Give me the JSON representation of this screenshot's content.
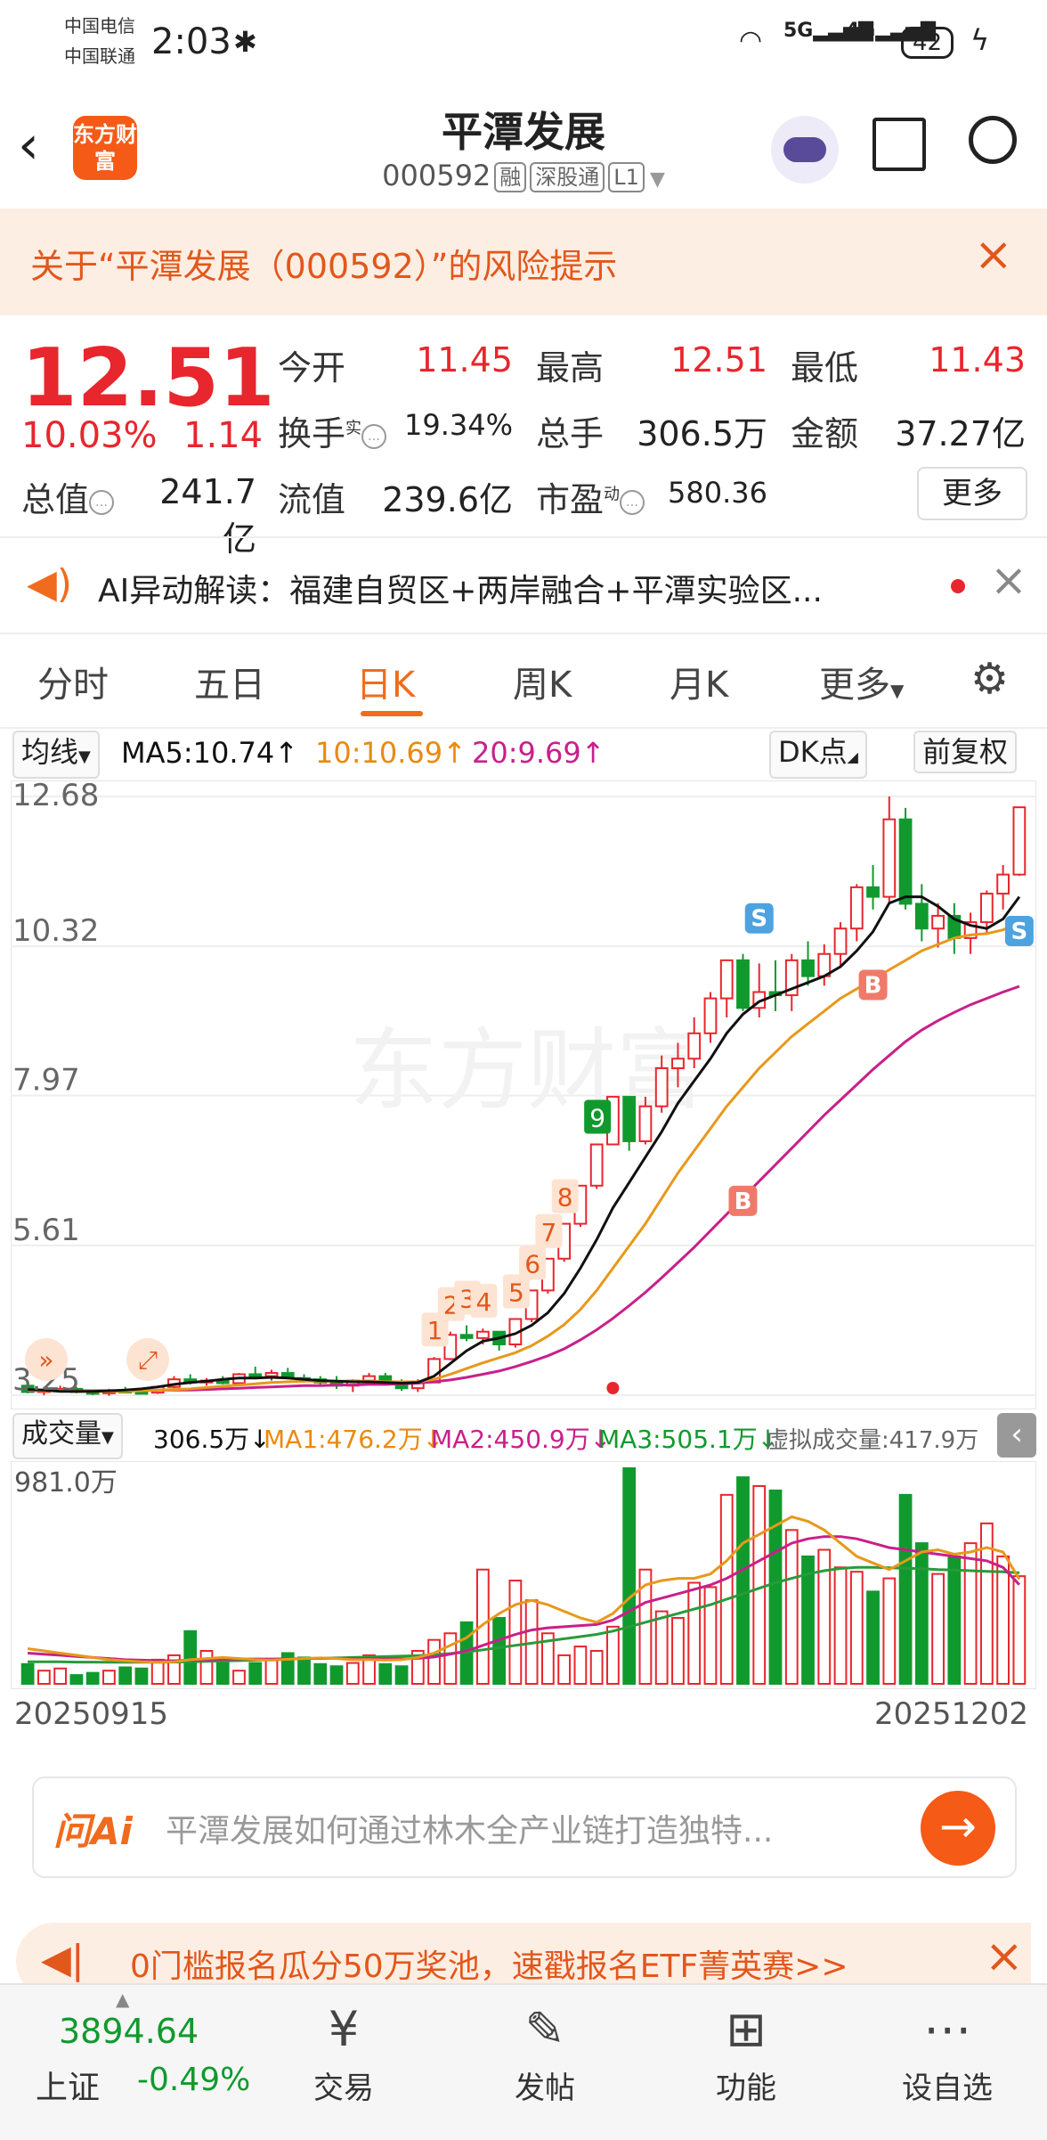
{
  "status_bar": {
    "carrier1": "中国电信",
    "carrier2": "中国联通",
    "time": "2:03",
    "battery": "42"
  },
  "header": {
    "brand_logo": "东方财富",
    "title": "平潭发展",
    "code": "000592",
    "tags": [
      "融",
      "深股通",
      "L1"
    ]
  },
  "risk_banner": {
    "text": "关于“平潭发展（000592）”的风险提示"
  },
  "quote": {
    "price": "12.51",
    "change_pct": "10.03%",
    "change": "1.14",
    "open_label": "今开",
    "open": "11.45",
    "high_label": "最高",
    "high": "12.51",
    "low_label": "最低",
    "low": "11.43",
    "turnover_label": "换手",
    "turnover_sup": "实",
    "turnover": "19.34%",
    "volume_label": "总手",
    "volume": "306.5万",
    "amount_label": "金额",
    "amount": "37.27亿",
    "mktcap_label": "总值",
    "mktcap": "241.7亿",
    "float_label": "流值",
    "float": "239.6亿",
    "pe_label": "市盈",
    "pe_sup": "动",
    "pe": "580.36",
    "more_label": "更多"
  },
  "ai_bar": {
    "text": "AI异动解读：福建自贸区+两岸融合+平潭实验区..."
  },
  "tabs": [
    "分时",
    "五日",
    "日K",
    "周K",
    "月K",
    "更多"
  ],
  "active_tab": "日K",
  "ma": {
    "selector": "均线",
    "ma5": "MA5:10.74↑",
    "ma10": "10:10.69↑",
    "ma20": "20:9.69↑",
    "dk_label": "DK点",
    "adjust_label": "前复权"
  },
  "volume_row": {
    "selector": "成交量",
    "vol": "306.5万↓",
    "ma1": "MA1:476.2万↓",
    "ma2": "MA2:450.9万↓",
    "ma3": "MA3:505.1万↓",
    "virtual": "虚拟成交量:417.9万"
  },
  "chart_data": {
    "type": "candlestick",
    "y_ticks": [
      "12.68",
      "10.32",
      "7.97",
      "5.61",
      "3.25"
    ],
    "ylim": [
      3.25,
      12.68
    ],
    "volume_max_label": "981.0万",
    "volume_max": 981.0,
    "x_start": "20250915",
    "x_end": "20251202",
    "up_color": "#e8262d",
    "down_color": "#109a2e",
    "ma5_color": "#111111",
    "ma10_color": "#e8981a",
    "ma20_color": "#c8208a",
    "candles": [
      [
        3.4,
        3.45,
        3.28,
        3.3
      ],
      [
        3.3,
        3.38,
        3.25,
        3.33
      ],
      [
        3.33,
        3.4,
        3.3,
        3.35
      ],
      [
        3.35,
        3.38,
        3.28,
        3.3
      ],
      [
        3.3,
        3.33,
        3.25,
        3.28
      ],
      [
        3.28,
        3.35,
        3.24,
        3.32
      ],
      [
        3.32,
        3.38,
        3.28,
        3.3
      ],
      [
        3.3,
        3.34,
        3.26,
        3.29
      ],
      [
        3.29,
        3.4,
        3.27,
        3.38
      ],
      [
        3.38,
        3.55,
        3.35,
        3.5
      ],
      [
        3.5,
        3.58,
        3.42,
        3.45
      ],
      [
        3.45,
        3.52,
        3.4,
        3.48
      ],
      [
        3.48,
        3.55,
        3.42,
        3.44
      ],
      [
        3.44,
        3.6,
        3.4,
        3.58
      ],
      [
        3.58,
        3.7,
        3.5,
        3.55
      ],
      [
        3.55,
        3.65,
        3.48,
        3.6
      ],
      [
        3.6,
        3.68,
        3.5,
        3.52
      ],
      [
        3.52,
        3.58,
        3.45,
        3.5
      ],
      [
        3.5,
        3.55,
        3.4,
        3.45
      ],
      [
        3.45,
        3.55,
        3.35,
        3.4
      ],
      [
        3.4,
        3.5,
        3.3,
        3.48
      ],
      [
        3.48,
        3.6,
        3.42,
        3.55
      ],
      [
        3.55,
        3.6,
        3.4,
        3.45
      ],
      [
        3.45,
        3.5,
        3.32,
        3.36
      ],
      [
        3.36,
        3.5,
        3.3,
        3.45
      ],
      [
        3.45,
        3.85,
        3.45,
        3.82
      ],
      [
        3.82,
        4.25,
        3.8,
        4.2
      ],
      [
        4.2,
        4.35,
        4.1,
        4.15
      ],
      [
        4.15,
        4.3,
        4.05,
        4.25
      ],
      [
        4.25,
        4.2,
        3.95,
        4.05
      ],
      [
        4.05,
        4.45,
        4.0,
        4.45
      ],
      [
        4.45,
        4.9,
        4.4,
        4.9
      ],
      [
        4.9,
        5.4,
        4.85,
        5.4
      ],
      [
        5.4,
        5.95,
        5.35,
        5.95
      ],
      [
        5.95,
        6.55,
        5.9,
        6.55
      ],
      [
        6.55,
        7.2,
        6.5,
        7.2
      ],
      [
        7.2,
        7.95,
        7.2,
        7.95
      ],
      [
        7.95,
        7.3,
        7.1,
        7.25
      ],
      [
        7.25,
        7.95,
        7.2,
        7.8
      ],
      [
        7.8,
        8.6,
        7.7,
        8.4
      ],
      [
        8.4,
        8.8,
        8.1,
        8.55
      ],
      [
        8.55,
        9.2,
        8.4,
        8.95
      ],
      [
        8.95,
        9.6,
        8.8,
        9.5
      ],
      [
        9.5,
        10.1,
        9.2,
        10.1
      ],
      [
        10.1,
        10.2,
        9.3,
        9.35
      ],
      [
        9.35,
        10.05,
        9.2,
        9.6
      ],
      [
        9.6,
        10.1,
        9.3,
        9.55
      ],
      [
        9.55,
        10.2,
        9.3,
        10.1
      ],
      [
        10.1,
        10.4,
        9.7,
        9.85
      ],
      [
        9.85,
        10.35,
        9.7,
        10.2
      ],
      [
        10.2,
        10.7,
        10.0,
        10.6
      ],
      [
        10.6,
        11.3,
        10.4,
        11.25
      ],
      [
        11.25,
        11.6,
        10.9,
        11.1
      ],
      [
        11.1,
        12.68,
        11.0,
        12.32
      ],
      [
        12.32,
        12.5,
        10.9,
        10.99
      ],
      [
        10.99,
        11.3,
        10.4,
        10.6
      ],
      [
        10.6,
        11.0,
        10.3,
        10.8
      ],
      [
        10.8,
        11.0,
        10.2,
        10.45
      ],
      [
        10.45,
        10.85,
        10.2,
        10.7
      ],
      [
        10.7,
        11.2,
        10.5,
        11.15
      ],
      [
        11.15,
        11.6,
        10.9,
        11.45
      ],
      [
        11.45,
        12.51,
        11.43,
        12.51
      ]
    ],
    "ma5": [
      3.34,
      3.33,
      3.31,
      3.31,
      3.31,
      3.32,
      3.33,
      3.35,
      3.38,
      3.42,
      3.45,
      3.47,
      3.5,
      3.52,
      3.52,
      3.53,
      3.52,
      3.5,
      3.48,
      3.47,
      3.46,
      3.46,
      3.45,
      3.44,
      3.45,
      3.55,
      3.75,
      3.95,
      4.1,
      4.15,
      4.22,
      4.35,
      4.55,
      4.85,
      5.25,
      5.7,
      6.2,
      6.6,
      7.0,
      7.4,
      7.85,
      8.2,
      8.55,
      8.95,
      9.25,
      9.45,
      9.55,
      9.65,
      9.75,
      9.85,
      10.0,
      10.25,
      10.55,
      11.0,
      11.1,
      11.1,
      10.95,
      10.75,
      10.65,
      10.6,
      10.75,
      11.1
    ],
    "ma10": [
      3.33,
      3.32,
      3.32,
      3.31,
      3.31,
      3.31,
      3.31,
      3.32,
      3.33,
      3.34,
      3.35,
      3.37,
      3.39,
      3.41,
      3.43,
      3.45,
      3.46,
      3.47,
      3.47,
      3.47,
      3.47,
      3.47,
      3.46,
      3.46,
      3.46,
      3.5,
      3.58,
      3.67,
      3.76,
      3.84,
      3.92,
      4.03,
      4.18,
      4.36,
      4.6,
      4.9,
      5.25,
      5.6,
      5.95,
      6.35,
      6.75,
      7.1,
      7.45,
      7.8,
      8.1,
      8.4,
      8.65,
      8.9,
      9.1,
      9.3,
      9.5,
      9.65,
      9.8,
      9.95,
      10.1,
      10.25,
      10.35,
      10.45,
      10.5,
      10.52,
      10.58,
      10.69
    ],
    "ma20": [
      3.32,
      3.32,
      3.32,
      3.32,
      3.32,
      3.32,
      3.32,
      3.32,
      3.33,
      3.33,
      3.33,
      3.34,
      3.35,
      3.36,
      3.37,
      3.38,
      3.39,
      3.4,
      3.4,
      3.41,
      3.41,
      3.42,
      3.42,
      3.43,
      3.44,
      3.46,
      3.49,
      3.53,
      3.58,
      3.63,
      3.7,
      3.78,
      3.87,
      3.98,
      4.12,
      4.28,
      4.46,
      4.66,
      4.87,
      5.1,
      5.34,
      5.58,
      5.84,
      6.1,
      6.36,
      6.62,
      6.88,
      7.14,
      7.4,
      7.66,
      7.9,
      8.14,
      8.38,
      8.6,
      8.82,
      9.0,
      9.15,
      9.28,
      9.4,
      9.5,
      9.6,
      9.69
    ],
    "volume": [
      90,
      60,
      70,
      40,
      50,
      60,
      75,
      70,
      110,
      130,
      240,
      150,
      110,
      60,
      95,
      110,
      140,
      120,
      90,
      80,
      95,
      130,
      90,
      80,
      150,
      200,
      230,
      280,
      520,
      300,
      470,
      380,
      230,
      130,
      170,
      150,
      260,
      981,
      520,
      330,
      300,
      460,
      440,
      860,
      940,
      900,
      880,
      700,
      580,
      610,
      530,
      510,
      420,
      480,
      860,
      640,
      500,
      580,
      640,
      730,
      580,
      490
    ],
    "ma1": [
      160,
      150,
      140,
      130,
      120,
      110,
      105,
      100,
      98,
      100,
      110,
      115,
      120,
      115,
      110,
      108,
      112,
      115,
      118,
      115,
      110,
      110,
      108,
      110,
      120,
      140,
      175,
      210,
      270,
      320,
      360,
      380,
      360,
      330,
      300,
      280,
      320,
      390,
      450,
      470,
      480,
      480,
      500,
      560,
      640,
      680,
      720,
      760,
      740,
      700,
      640,
      580,
      550,
      520,
      560,
      600,
      610,
      590,
      600,
      620,
      600,
      476
    ],
    "ma2": [
      140,
      135,
      130,
      125,
      120,
      115,
      110,
      108,
      106,
      105,
      108,
      110,
      112,
      113,
      113,
      113,
      114,
      115,
      116,
      116,
      116,
      115,
      114,
      114,
      116,
      122,
      135,
      150,
      175,
      200,
      225,
      245,
      255,
      260,
      265,
      270,
      290,
      330,
      370,
      390,
      410,
      430,
      450,
      480,
      520,
      560,
      600,
      640,
      660,
      670,
      670,
      660,
      640,
      620,
      610,
      600,
      590,
      580,
      570,
      560,
      530,
      451
    ],
    "ma3": [
      100,
      100,
      100,
      99,
      99,
      98,
      98,
      98,
      98,
      99,
      100,
      102,
      104,
      106,
      108,
      110,
      112,
      114,
      116,
      118,
      120,
      122,
      124,
      126,
      128,
      132,
      138,
      145,
      155,
      165,
      175,
      185,
      195,
      205,
      215,
      225,
      240,
      260,
      280,
      300,
      320,
      340,
      360,
      385,
      410,
      435,
      460,
      480,
      500,
      515,
      525,
      530,
      530,
      528,
      526,
      524,
      520,
      518,
      515,
      512,
      510,
      505
    ]
  },
  "chart_markers": {
    "td_numbers": [
      "1",
      "2",
      "3",
      "4",
      "5",
      "6",
      "7",
      "8",
      "9"
    ],
    "buy_label": "B",
    "sell_label": "S",
    "watermark": "东方财富"
  },
  "ask_ai": {
    "brand": "问Ai",
    "placeholder": "平潭发展如何通过林木全产业链打造独特..."
  },
  "promo": {
    "text": "0门槛报名瓜分50万奖池，速戳报名ETF菁英赛>>"
  },
  "index_ticker": {
    "value": "3894.64",
    "name": "上证",
    "change": "-0.49%"
  },
  "bottom_nav": [
    {
      "label": "交易",
      "icon": "yen-cycle-icon"
    },
    {
      "label": "发帖",
      "icon": "edit-icon"
    },
    {
      "label": "功能",
      "icon": "grid-icon"
    },
    {
      "label": "设自选",
      "icon": "more-circle-icon"
    }
  ]
}
